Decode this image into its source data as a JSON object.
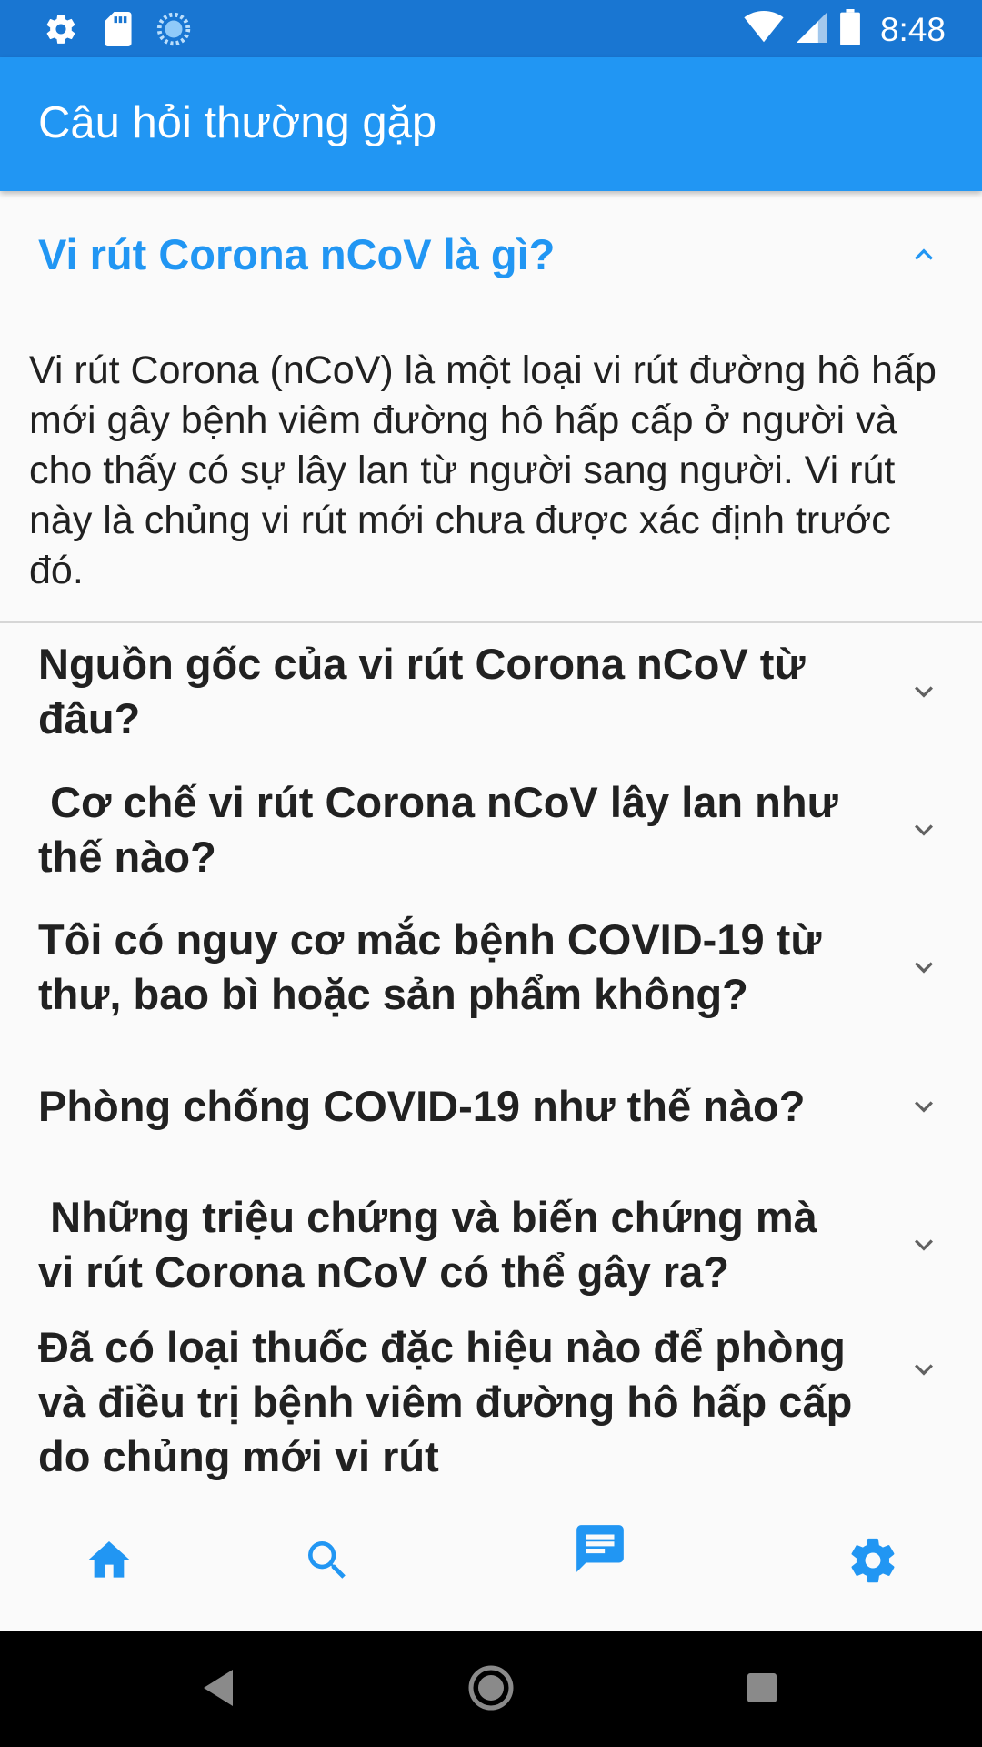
{
  "status_bar": {
    "time": "8:48",
    "left_icons": [
      "settings-icon",
      "sd-card-icon",
      "sync-icon"
    ],
    "right_icons": [
      "wifi-icon",
      "signal-icon",
      "battery-icon"
    ]
  },
  "app_bar": {
    "title": "Câu hỏi thường gặp"
  },
  "colors": {
    "status_bar": "#1976d2",
    "app_bar": "#2196f3",
    "accent": "#2196f3",
    "text": "#212121",
    "background": "#fafafa"
  },
  "faq": {
    "items": [
      {
        "question": "Vi rút Corona nCoV là gì?",
        "expanded": true,
        "answer": "Vi rút Corona (nCoV) là một loại vi rút đường hô hấp mới gây bệnh viêm đường hô hấp cấp ở người và cho thấy có sự lây lan từ người sang người. Vi rút này là chủng vi rút mới chưa được xác định trước đó."
      },
      {
        "question": "Nguồn gốc của vi rút Corona nCoV từ đâu?",
        "expanded": false
      },
      {
        "question": " Cơ chế vi rút Corona nCoV lây lan như thế nào?",
        "expanded": false
      },
      {
        "question": "Tôi có nguy cơ mắc bệnh COVID-19 từ thư, bao bì hoặc sản phẩm không?",
        "expanded": false
      },
      {
        "question": "Phòng chống COVID-19 như thế nào?",
        "expanded": false
      },
      {
        "question": " Những triệu chứng và biến chứng mà vi rút Corona nCoV có thể gây ra?",
        "expanded": false
      },
      {
        "question": "Đã có loại thuốc đặc hiệu nào để phòng và điều trị bệnh viêm đường hô hấp cấp do chủng mới vi rút",
        "expanded": false
      }
    ]
  },
  "bottom_nav": {
    "items": [
      "home-icon",
      "search-icon",
      "chat-icon",
      "settings-icon"
    ],
    "active": "chat-icon"
  },
  "system_nav": [
    "back-icon",
    "home-circle-icon",
    "recents-icon"
  ]
}
